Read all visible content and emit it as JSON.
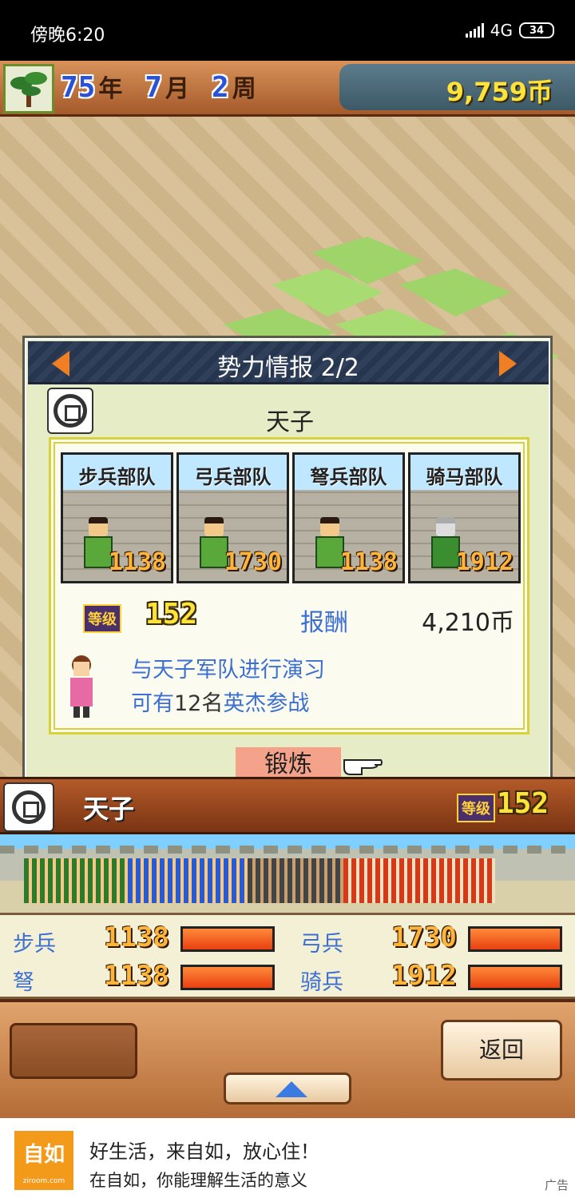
{
  "status_bar": {
    "time": "傍晚6:20",
    "network": "4G",
    "battery": "34"
  },
  "header": {
    "year": "75",
    "year_unit": "年",
    "month": "7",
    "month_unit": "月",
    "week": "2",
    "week_unit": "周",
    "money": "9,759币"
  },
  "dialog": {
    "title": "势力情报 2/2",
    "faction_name": "天子",
    "units": [
      {
        "name": "步兵部队",
        "value": "1138"
      },
      {
        "name": "弓兵部队",
        "value": "1730"
      },
      {
        "name": "弩兵部队",
        "value": "1138"
      },
      {
        "name": "骑马部队",
        "value": "1912"
      }
    ],
    "level_label": "等级",
    "level": "152",
    "reward_label": "报酬",
    "reward_value": "4,210币",
    "desc_line1": "与天子军队进行演习",
    "desc_line2_a": "可有",
    "desc_line2_b": "12名",
    "desc_line2_c": "英杰参战",
    "train_button": "锻炼"
  },
  "faction_bar": {
    "name": "天子",
    "level_label": "等级",
    "level": "152"
  },
  "stats": {
    "infantry": {
      "label": "步兵",
      "value": "1138",
      "fill": 1.0
    },
    "archer": {
      "label": "弓兵",
      "value": "1730",
      "fill": 1.0
    },
    "crossbow": {
      "label": "弩",
      "value": "1138",
      "fill": 1.0
    },
    "cavalry": {
      "label": "骑兵",
      "value": "1912",
      "fill": 1.0
    }
  },
  "controls": {
    "back_button": "返回"
  },
  "ad": {
    "logo": "自如",
    "logo_sub": "ziroom.com",
    "line1": "好生活，来自如，放心住！",
    "line2": "在自如，你能理解生活的意义",
    "tag": "广告"
  },
  "colors": {
    "accent_orange": "#f07e22",
    "gold_text": "#ffe23a",
    "link_blue": "#3b6fd2"
  }
}
